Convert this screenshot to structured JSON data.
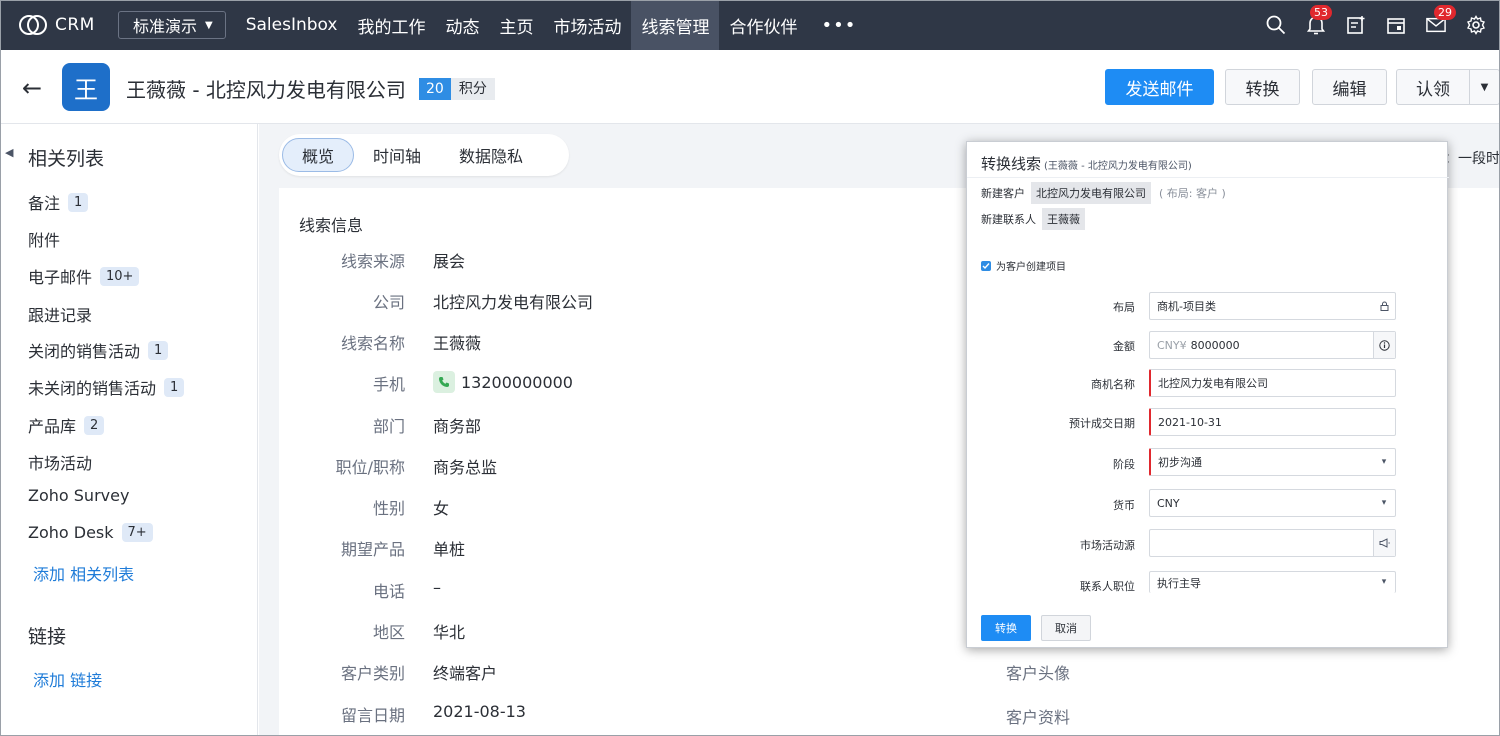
{
  "app": {
    "logo_text": "CRM",
    "org": "标准演示"
  },
  "nav": {
    "tabs": [
      "SalesInbox",
      "我的工作",
      "动态",
      "主页",
      "市场活动",
      "线索管理",
      "合作伙伴"
    ],
    "active_tab": "线索管理",
    "more": "•••",
    "notifications_count": "53",
    "mail_count": "29"
  },
  "record": {
    "avatar_letter": "王",
    "title": "王薇薇 - 北控风力发电有限公司",
    "score": "20",
    "score_label": "积分",
    "buttons": {
      "send_mail": "发送邮件",
      "convert": "转换",
      "edit": "编辑",
      "claim": "认领"
    }
  },
  "sidebar": {
    "title": "相关列表",
    "items": [
      {
        "label": "备注",
        "count": "1"
      },
      {
        "label": "附件",
        "count": ""
      },
      {
        "label": "电子邮件",
        "count": "10+"
      },
      {
        "label": "跟进记录",
        "count": ""
      },
      {
        "label": "关闭的销售活动",
        "count": "1"
      },
      {
        "label": "未关闭的销售活动",
        "count": "1"
      },
      {
        "label": "产品库",
        "count": "2"
      },
      {
        "label": "市场活动",
        "count": ""
      },
      {
        "label": "Zoho Survey",
        "count": ""
      },
      {
        "label": "Zoho Desk",
        "count": "7+"
      }
    ],
    "add_related": "添加 相关列表",
    "links_title": "链接",
    "add_link": "添加 链接"
  },
  "content": {
    "tabs": [
      "概览",
      "时间轴",
      "数据隐私"
    ],
    "right_hint": "：一段时",
    "section_title": "线索信息",
    "fields": [
      {
        "label": "线索来源",
        "value": "展会"
      },
      {
        "label": "公司",
        "value": "北控风力发电有限公司"
      },
      {
        "label": "线索名称",
        "value": "王薇薇"
      },
      {
        "label": "手机",
        "value": "13200000000"
      },
      {
        "label": "部门",
        "value": "商务部"
      },
      {
        "label": "职位/职称",
        "value": "商务总监"
      },
      {
        "label": "性别",
        "value": "女"
      },
      {
        "label": "期望产品",
        "value": "单桩"
      },
      {
        "label": "电话",
        "value": "–"
      },
      {
        "label": "地区",
        "value": "华北"
      },
      {
        "label": "客户类别",
        "value": "终端客户"
      },
      {
        "label": "留言日期",
        "value": "2021-08-13"
      }
    ],
    "right_labels": [
      "客户头像",
      "客户资料"
    ]
  },
  "modal": {
    "title": "转换线索",
    "subtitle": "(王薇薇 - 北控风力发电有限公司)",
    "new_account_label": "新建客户",
    "new_account_value": "北控风力发电有限公司",
    "new_account_note": "( 布局: 客户 )",
    "new_contact_label": "新建联系人",
    "new_contact_value": "王薇薇",
    "create_deal_label": "为客户创建项目",
    "fields": [
      {
        "label": "布局",
        "value": "商机-项目类",
        "prefix": "",
        "suffix": "lock-icon",
        "required": false
      },
      {
        "label": "金额",
        "value": "8000000",
        "prefix": "CNY¥",
        "suffix": "info-icon",
        "required": false
      },
      {
        "label": "商机名称",
        "value": "北控风力发电有限公司",
        "prefix": "",
        "suffix": "",
        "required": true
      },
      {
        "label": "预计成交日期",
        "value": "2021-10-31",
        "prefix": "",
        "suffix": "",
        "required": true
      },
      {
        "label": "阶段",
        "value": "初步沟通",
        "prefix": "",
        "suffix": "caret",
        "required": true
      },
      {
        "label": "货币",
        "value": "CNY",
        "prefix": "",
        "suffix": "caret",
        "required": false
      },
      {
        "label": "市场活动源",
        "value": "",
        "prefix": "",
        "suffix": "megaphone-icon",
        "required": false
      },
      {
        "label": "联系人职位",
        "value": "执行主导",
        "prefix": "",
        "suffix": "caret",
        "required": false
      }
    ],
    "convert_button": "转换",
    "cancel_button": "取消"
  },
  "colors": {
    "nav_bg": "#2f3746",
    "primary": "#1e8cf4",
    "avatar": "#1e6fc9",
    "badge": "#e0282e",
    "link": "#1e7bd8"
  }
}
